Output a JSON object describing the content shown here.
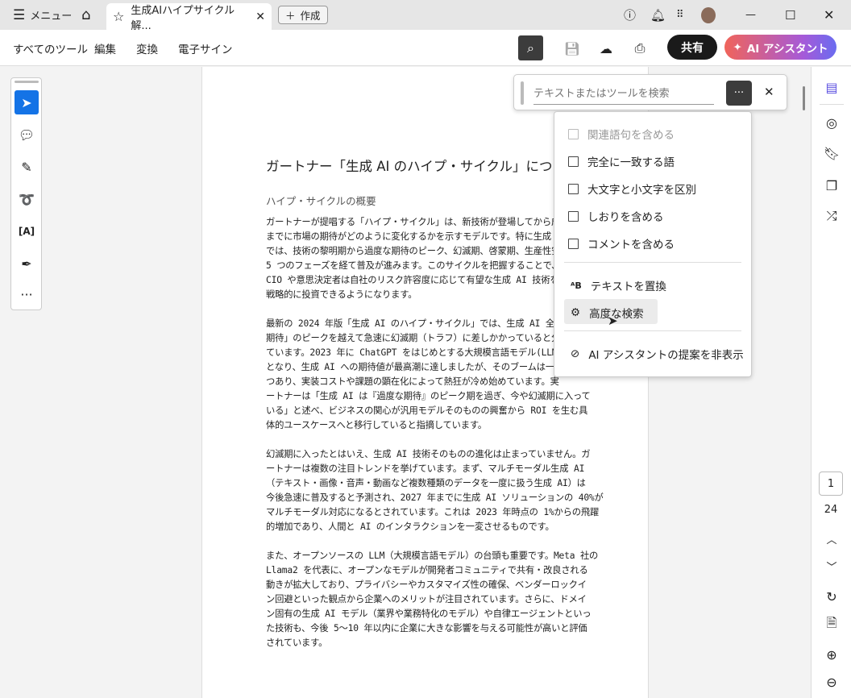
{
  "tabbar": {
    "menu_label": "メニュー",
    "tab_title": "生成AIハイプサイクル解...",
    "create_label": "作成"
  },
  "toolbar": {
    "menus": [
      "すべてのツール",
      "編集",
      "変換",
      "電子サイン"
    ],
    "share_label": "共有",
    "ai_label": "AI アシスタント"
  },
  "search": {
    "placeholder": "テキストまたはツールを検索",
    "more_label": "···"
  },
  "dropdown": {
    "options": [
      "関連語句を含める",
      "完全に一致する語",
      "大文字と小文字を区別",
      "しおりを含める",
      "コメントを含める"
    ],
    "replace_label": "テキストを置換",
    "advanced_label": "高度な検索",
    "hide_ai_label": "AI アシスタントの提案を非表示"
  },
  "document": {
    "title": "ガートナー「生成 AI のハイプ・サイクル」につ",
    "subtitle": "ハイプ・サイクルの概要",
    "p1": [
      "ガートナーが提唱する「ハイプ・サイクル」は、新技術が登場してから成",
      "までに市場の期待がどのように変化するかを示すモデルです。特に生成",
      "では、技術の黎明期から過度な期待のピーク、幻滅期、啓蒙期、生産性安",
      "5 つのフェーズを経て普及が進みます。このサイクルを把握することで、",
      "CIO や意思決定者は自社のリスク許容度に応じて有望な生成 AI 技術を見",
      "戦略的に投資できるようになります。"
    ],
    "p2": [
      "最新の 2024 年版「生成 AI のハイプ・サイクル」では、生成 AI 全体が",
      "期待」のピークを越えて急速に幻滅期（トラフ）に差しかかっていると分",
      "ています。2023 年に ChatGPT をはじめとする大規模言語モデル(LLM)が社",
      "となり、生成 AI への期待値が最高潮に達しましたが、そのブームは一段",
      "つあり、実装コストや課題の顕在化によって熱狂が冷め始めています。実",
      "ートナーは「生成 AI は『過度な期待』のピーク期を過ぎ、今や幻滅期に入って",
      "いる」と述べ、ビジネスの関心が汎用モデルそのものの興奮から ROI を生む具",
      "体的ユースケースへと移行していると指摘しています。"
    ],
    "p3": [
      "幻滅期に入ったとはいえ、生成 AI 技術そのものの進化は止まっていません。ガ",
      "ートナーは複数の注目トレンドを挙げています。まず、マルチモーダル生成 AI",
      "（テキスト・画像・音声・動画など複数種類のデータを一度に扱う生成 AI）は",
      "今後急速に普及すると予測され、2027 年までに生成 AI ソリューションの 40%が",
      "マルチモーダル対応になるとされています。これは 2023 年時点の 1%からの飛躍",
      "的増加であり、人間と AI のインタラクションを一変させるものです。"
    ],
    "p4": [
      "また、オープンソースの LLM（大規模言語モデル）の台頭も重要です。Meta 社の",
      "Llama2 を代表に、オープンなモデルが開発者コミュニティで共有・改良される",
      "動きが拡大しており、プライバシーやカスタマイズ性の確保、ベンダーロックイ",
      "ン回避といった観点から企業へのメリットが注目されています。さらに、ドメイ",
      "ン固有の生成 AI モデル（業界や業務特化のモデル）や自律エージェントといっ",
      "た技術も、今後 5～10 年以内に企業に大きな影響を与える可能性が高いと評価",
      "されています。"
    ]
  },
  "pagination": {
    "current": "1",
    "total": "24"
  },
  "colors": {
    "accent": "#1473e6",
    "share_bg": "#1a1a1a"
  }
}
